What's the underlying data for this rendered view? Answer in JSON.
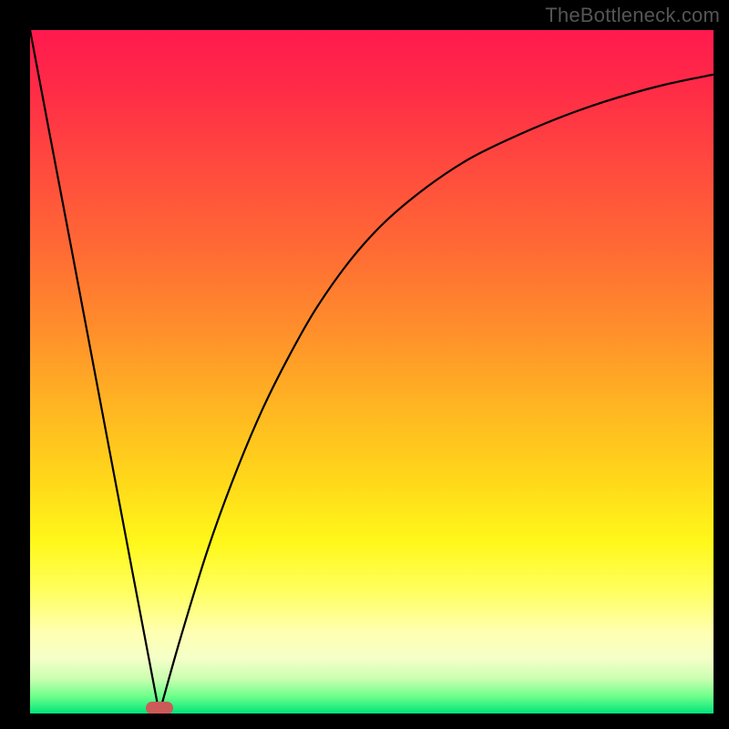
{
  "watermark": "TheBottleneck.com",
  "marker": {
    "x_frac": 0.189,
    "y_frac": 0.992
  },
  "chart_data": {
    "type": "line",
    "title": "",
    "xlabel": "",
    "ylabel": "",
    "xlim": [
      0,
      1
    ],
    "ylim": [
      0,
      1
    ],
    "series": [
      {
        "name": "left-branch",
        "x": [
          0.0,
          0.03,
          0.06,
          0.09,
          0.12,
          0.15,
          0.18,
          0.189
        ],
        "y": [
          1.0,
          0.841,
          0.683,
          0.524,
          0.365,
          0.206,
          0.048,
          0.0
        ]
      },
      {
        "name": "right-branch",
        "x": [
          0.189,
          0.22,
          0.26,
          0.3,
          0.34,
          0.38,
          0.42,
          0.47,
          0.52,
          0.58,
          0.64,
          0.7,
          0.77,
          0.84,
          0.92,
          1.0
        ],
        "y": [
          0.0,
          0.11,
          0.24,
          0.35,
          0.445,
          0.525,
          0.595,
          0.665,
          0.72,
          0.77,
          0.81,
          0.84,
          0.87,
          0.895,
          0.918,
          0.935
        ]
      }
    ],
    "marker": {
      "x": 0.189,
      "y": 0.008
    }
  }
}
